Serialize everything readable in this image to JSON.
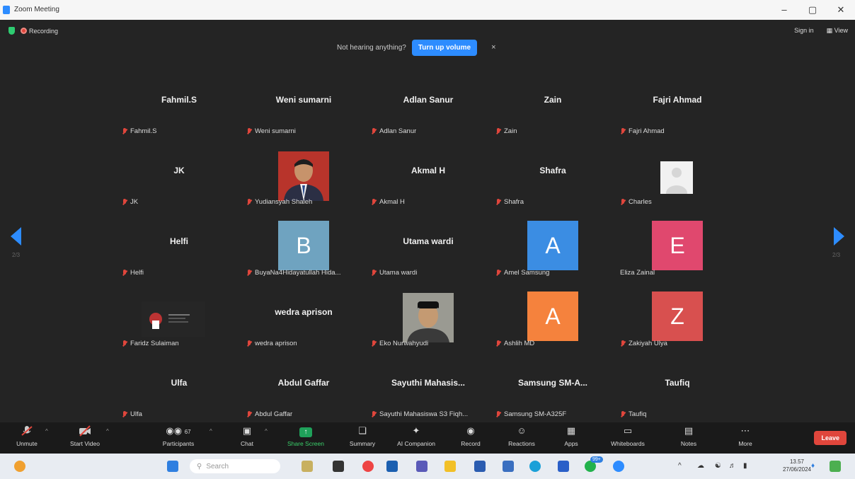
{
  "window": {
    "title": "Zoom Meeting",
    "controls": [
      "–",
      "▢",
      "✕"
    ]
  },
  "meeting_header": {
    "recording_label": "Recording",
    "sign_in": "Sign in",
    "view": "View",
    "banner_text": "Not hearing anything?",
    "banner_button": "Turn up volume",
    "banner_close": "×"
  },
  "pages": {
    "left": "2/3",
    "right": "2/3"
  },
  "tiles": [
    {
      "big": "Fahmil.S",
      "label": "Fahmil.S"
    },
    {
      "big": "Weni sumarni",
      "label": "Weni sumarni"
    },
    {
      "big": "Adlan Sanur",
      "label": "Adlan Sanur"
    },
    {
      "big": "Zain",
      "label": "Zain"
    },
    {
      "big": "Fajri Ahmad",
      "label": "Fajri Ahmad"
    },
    {
      "big": "JK",
      "label": "JK"
    },
    {
      "big": "",
      "label": "Yudiansyah Shaleh"
    },
    {
      "big": "Akmal H",
      "label": "Akmal H"
    },
    {
      "big": "Shafra",
      "label": "Shafra"
    },
    {
      "big": "",
      "label": "Charles"
    },
    {
      "big": "Helfi",
      "label": "Helfi"
    },
    {
      "big": "B",
      "label": "BuyaNa4Hidayatullah Hida..."
    },
    {
      "big": "Utama wardi",
      "label": "Utama wardi"
    },
    {
      "big": "A",
      "label": "Amel Samsung"
    },
    {
      "big": "E",
      "label": "Eliza Zainal"
    },
    {
      "big": "",
      "label": "Faridz Sulaiman"
    },
    {
      "big": "wedra aprison",
      "label": "wedra aprison"
    },
    {
      "big": "",
      "label": "Eko Nurwahyudi"
    },
    {
      "big": "A",
      "label": "Ashlih MD"
    },
    {
      "big": "Z",
      "label": "Zakiyah Ulya"
    },
    {
      "big": "Ulfa",
      "label": "Ulfa"
    },
    {
      "big": "Abdul Gaffar",
      "label": "Abdul Gaffar"
    },
    {
      "big": "Sayuthi  Mahasis...",
      "label": "Sayuthi Mahasiswa S3 Fiqh..."
    },
    {
      "big": "Samsung  SM-A...",
      "label": "Samsung SM-A325F"
    },
    {
      "big": "Taufiq",
      "label": "Taufiq"
    }
  ],
  "avatar_colors": {
    "B": "#6fa3c0",
    "A1": "#3b8de3",
    "E": "#e0486e",
    "A2": "#f5823d",
    "Z": "#d8504f"
  },
  "toolbar": {
    "unmute": "Unmute",
    "start_video": "Start Video",
    "participants": "Participants",
    "participants_count": "67",
    "chat": "Chat",
    "share_screen": "Share Screen",
    "summary": "Summary",
    "ai_companion": "AI Companion",
    "record": "Record",
    "reactions": "Reactions",
    "apps": "Apps",
    "whiteboards": "Whiteboards",
    "notes": "Notes",
    "more": "More",
    "leave": "Leave"
  },
  "taskbar": {
    "search_placeholder": "Search",
    "time": "13.57",
    "date": "27/06/2024",
    "notif_badge": "99+"
  }
}
